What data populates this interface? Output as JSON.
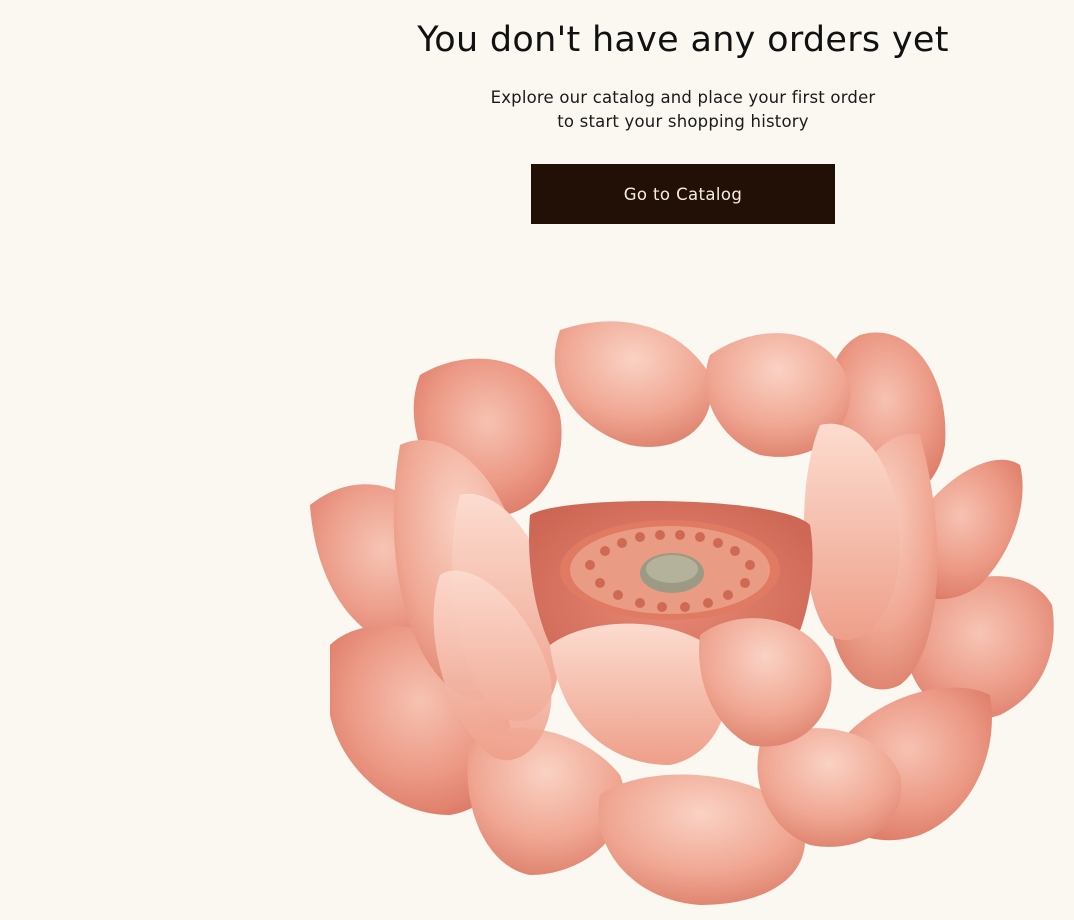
{
  "empty_state": {
    "title": "You don't have any orders yet",
    "subtitle_line1": "Explore our catalog and place your first order",
    "subtitle_line2": "to start your shopping history",
    "cta_label": "Go to Catalog"
  },
  "illustration": {
    "icon": "lotus-flower-illustration"
  },
  "colors": {
    "background": "#fbf7f1",
    "cta_background": "#221007",
    "cta_text": "#f5ece2",
    "petal": "#ec9a86"
  }
}
